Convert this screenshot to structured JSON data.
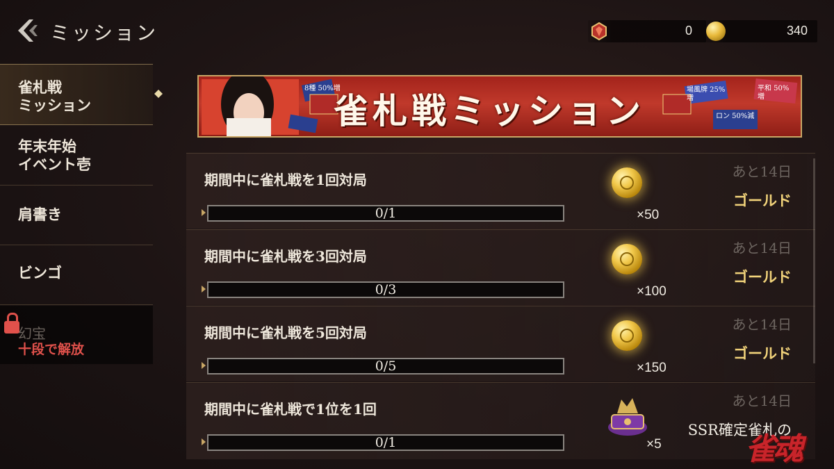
{
  "header": {
    "title": "ミッション"
  },
  "currency": {
    "gem_value": "0",
    "coin_value": "340"
  },
  "sidebar": {
    "items": [
      {
        "label": "雀札戦\nミッション",
        "active": true
      },
      {
        "label": "年末年始\nイベント壱",
        "active": false
      },
      {
        "label": "肩書き",
        "active": false
      },
      {
        "label": "ビンゴ",
        "active": false
      },
      {
        "label": "幻宝",
        "lock_text": "十段で解放",
        "locked": true
      }
    ]
  },
  "banner": {
    "title": "雀札戦ミッション",
    "tags": [
      "8種 50%増",
      "場風牌 25%増",
      "平和 50%増",
      "ロン 50%減"
    ]
  },
  "missions": [
    {
      "title": "期間中に雀札戦を1回対局",
      "progress": "0/1",
      "progress_fraction": 0,
      "remaining": "あと14日",
      "reward_name": "ゴールド",
      "reward_qty": "×50",
      "reward_icon": "gold-coin-icon"
    },
    {
      "title": "期間中に雀札戦を3回対局",
      "progress": "0/3",
      "progress_fraction": 0,
      "remaining": "あと14日",
      "reward_name": "ゴールド",
      "reward_qty": "×100",
      "reward_icon": "gold-coin-icon"
    },
    {
      "title": "期間中に雀札戦を5回対局",
      "progress": "0/5",
      "progress_fraction": 0,
      "remaining": "あと14日",
      "reward_name": "ゴールド",
      "reward_qty": "×150",
      "reward_icon": "gold-coin-icon"
    },
    {
      "title": "期間中に雀札戦で1位を1回",
      "progress": "0/1",
      "progress_fraction": 0,
      "remaining": "あと14日",
      "reward_name": "SSR確定雀札の",
      "reward_qty": "×5",
      "reward_icon": "treasure-chest-icon"
    }
  ],
  "watermark": {
    "text": "雀魂"
  },
  "colors": {
    "accent_gold": "#c9a766",
    "reward_text": "#f0d27a",
    "lock_red": "#e0514b",
    "banner_red": "#c0392b"
  }
}
